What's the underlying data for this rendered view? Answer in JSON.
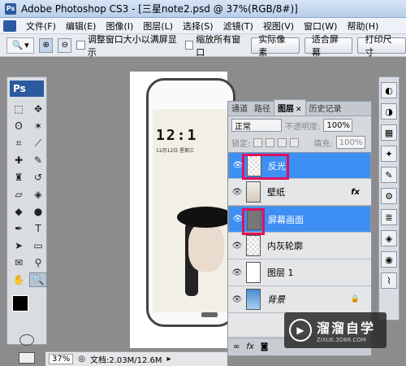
{
  "window": {
    "title": "Adobe Photoshop CS3 - [三星note2.psd @ 37%(RGB/8#)]"
  },
  "menu": [
    "文件(F)",
    "编辑(E)",
    "图像(I)",
    "图层(L)",
    "选择(S)",
    "滤镜(T)",
    "视图(V)",
    "窗口(W)",
    "帮助(H)"
  ],
  "options": {
    "resize_window": "调整窗口大小以满屏显示",
    "zoom_all": "缩放所有窗口",
    "actual_pixels": "实际像素",
    "fit_screen": "适合屏幕",
    "print_size": "打印尺寸"
  },
  "toolbox": {
    "logo": "Ps"
  },
  "canvas": {
    "time": "12:1",
    "date": "12月12日 星期三"
  },
  "layers_panel": {
    "tabs": [
      "通道",
      "路径",
      "图层",
      "历史记录"
    ],
    "blend_mode": "正常",
    "opacity_label": "不透明度:",
    "opacity_value": "100%",
    "lock_label": "锁定:",
    "fill_label": "填充:",
    "fill_value": "100%",
    "layers": [
      {
        "name": "反光",
        "selected": true
      },
      {
        "name": "壁纸",
        "selected": false,
        "fx": "fx"
      },
      {
        "name": "屏幕画面",
        "selected": true
      },
      {
        "name": "内灰轮廓",
        "selected": false
      },
      {
        "name": "图层 1",
        "selected": false
      },
      {
        "name": "背景",
        "selected": false
      }
    ]
  },
  "status": {
    "zoom": "37%",
    "doc": "文档:2.03M/12.6M"
  },
  "watermark": {
    "name": "溜溜自学",
    "url": "ZIXUE.3D66.COM"
  }
}
